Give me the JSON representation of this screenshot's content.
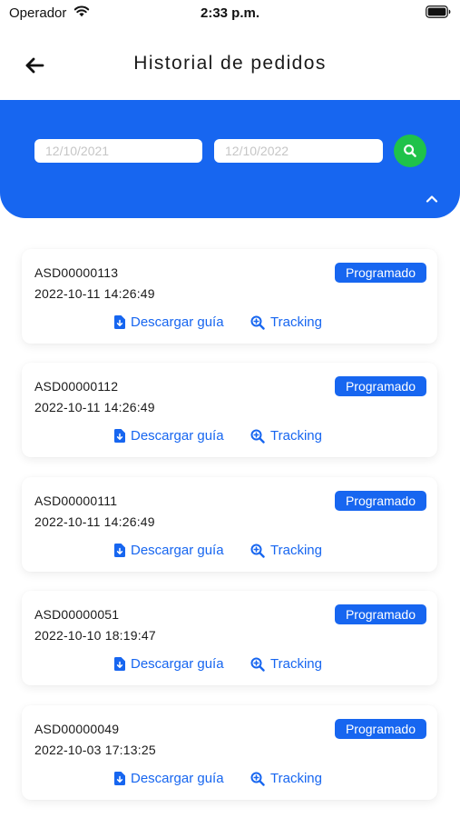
{
  "status_bar": {
    "carrier": "Operador",
    "time": "2:33 p.m."
  },
  "header": {
    "title": "Historial de pedidos"
  },
  "filters": {
    "date_from_placeholder": "12/10/2021",
    "date_to_placeholder": "12/10/2022"
  },
  "colors": {
    "primary": "#1766f0",
    "search_button": "#1fc24a"
  },
  "orders": [
    {
      "id": "ASD00000113",
      "datetime": "2022-10-11 14:26:49",
      "status": "Programado",
      "download_label": "Descargar guía",
      "tracking_label": "Tracking"
    },
    {
      "id": "ASD00000112",
      "datetime": "2022-10-11 14:26:49",
      "status": "Programado",
      "download_label": "Descargar guía",
      "tracking_label": "Tracking"
    },
    {
      "id": "ASD00000111",
      "datetime": "2022-10-11 14:26:49",
      "status": "Programado",
      "download_label": "Descargar guía",
      "tracking_label": "Tracking"
    },
    {
      "id": "ASD00000051",
      "datetime": "2022-10-10 18:19:47",
      "status": "Programado",
      "download_label": "Descargar guía",
      "tracking_label": "Tracking"
    },
    {
      "id": "ASD00000049",
      "datetime": "2022-10-03 17:13:25",
      "status": "Programado",
      "download_label": "Descargar guía",
      "tracking_label": "Tracking"
    }
  ]
}
